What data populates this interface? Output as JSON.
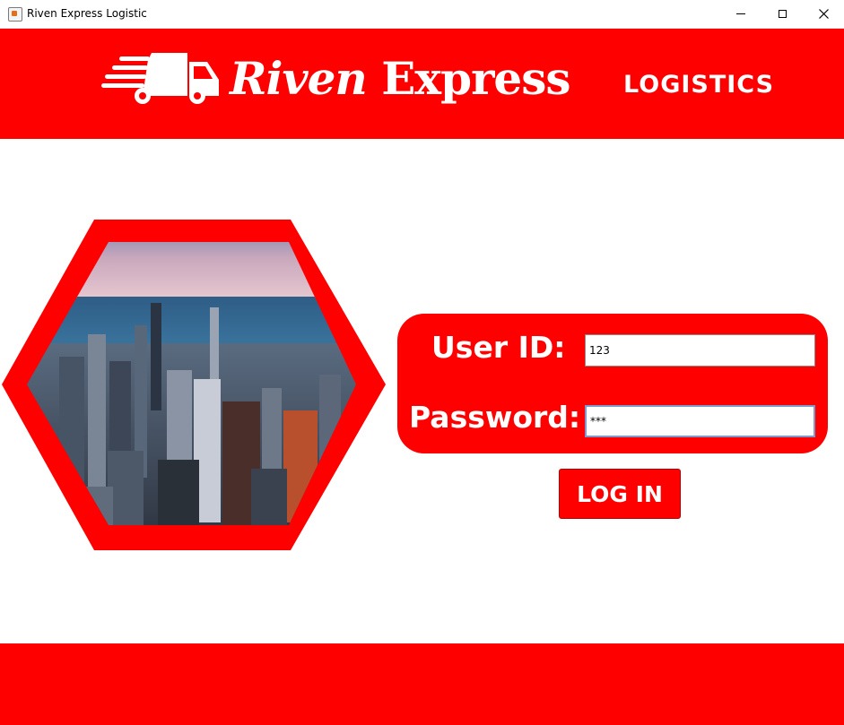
{
  "window": {
    "title": "Riven Express Logistic",
    "controls": [
      "minimize",
      "maximize",
      "close"
    ]
  },
  "header": {
    "brand_part1": "Riven",
    "brand_part2": "Express",
    "brand_sub": "LOGISTICS",
    "logo_icon": "delivery-truck-icon"
  },
  "login": {
    "user_label": "User ID:",
    "user_value": "123",
    "password_label": "Password:",
    "password_value": "***",
    "button_label": "LOG IN"
  },
  "colors": {
    "brand_red": "#ff0000",
    "white": "#ffffff"
  }
}
